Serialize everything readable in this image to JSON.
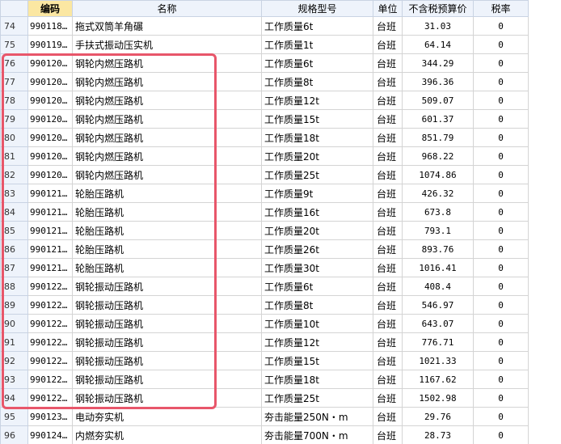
{
  "headers": {
    "row": "",
    "code": "编码",
    "name": "名称",
    "spec": "规格型号",
    "unit": "单位",
    "price": "不含税预算价",
    "tax": "税率"
  },
  "rows": [
    {
      "n": "74",
      "code": "990118…",
      "name": "拖式双筒羊角碾",
      "spec": "工作质量6t",
      "unit": "台班",
      "price": "31.03",
      "tax": "0"
    },
    {
      "n": "75",
      "code": "990119…",
      "name": "手扶式振动压实机",
      "spec": "工作质量1t",
      "unit": "台班",
      "price": "64.14",
      "tax": "0"
    },
    {
      "n": "76",
      "code": "990120…",
      "name": "钢轮内燃压路机",
      "spec": "工作质量6t",
      "unit": "台班",
      "price": "344.29",
      "tax": "0"
    },
    {
      "n": "77",
      "code": "990120…",
      "name": "钢轮内燃压路机",
      "spec": "工作质量8t",
      "unit": "台班",
      "price": "396.36",
      "tax": "0"
    },
    {
      "n": "78",
      "code": "990120…",
      "name": "钢轮内燃压路机",
      "spec": "工作质量12t",
      "unit": "台班",
      "price": "509.07",
      "tax": "0"
    },
    {
      "n": "79",
      "code": "990120…",
      "name": "钢轮内燃压路机",
      "spec": "工作质量15t",
      "unit": "台班",
      "price": "601.37",
      "tax": "0"
    },
    {
      "n": "80",
      "code": "990120…",
      "name": "钢轮内燃压路机",
      "spec": "工作质量18t",
      "unit": "台班",
      "price": "851.79",
      "tax": "0"
    },
    {
      "n": "81",
      "code": "990120…",
      "name": "钢轮内燃压路机",
      "spec": "工作质量20t",
      "unit": "台班",
      "price": "968.22",
      "tax": "0"
    },
    {
      "n": "82",
      "code": "990120…",
      "name": "钢轮内燃压路机",
      "spec": "工作质量25t",
      "unit": "台班",
      "price": "1074.86",
      "tax": "0"
    },
    {
      "n": "83",
      "code": "990121…",
      "name": "轮胎压路机",
      "spec": "工作质量9t",
      "unit": "台班",
      "price": "426.32",
      "tax": "0"
    },
    {
      "n": "84",
      "code": "990121…",
      "name": "轮胎压路机",
      "spec": "工作质量16t",
      "unit": "台班",
      "price": "673.8",
      "tax": "0"
    },
    {
      "n": "85",
      "code": "990121…",
      "name": "轮胎压路机",
      "spec": "工作质量20t",
      "unit": "台班",
      "price": "793.1",
      "tax": "0"
    },
    {
      "n": "86",
      "code": "990121…",
      "name": "轮胎压路机",
      "spec": "工作质量26t",
      "unit": "台班",
      "price": "893.76",
      "tax": "0"
    },
    {
      "n": "87",
      "code": "990121…",
      "name": "轮胎压路机",
      "spec": "工作质量30t",
      "unit": "台班",
      "price": "1016.41",
      "tax": "0"
    },
    {
      "n": "88",
      "code": "990122…",
      "name": "钢轮振动压路机",
      "spec": "工作质量6t",
      "unit": "台班",
      "price": "408.4",
      "tax": "0"
    },
    {
      "n": "89",
      "code": "990122…",
      "name": "钢轮振动压路机",
      "spec": "工作质量8t",
      "unit": "台班",
      "price": "546.97",
      "tax": "0"
    },
    {
      "n": "90",
      "code": "990122…",
      "name": "钢轮振动压路机",
      "spec": "工作质量10t",
      "unit": "台班",
      "price": "643.07",
      "tax": "0"
    },
    {
      "n": "91",
      "code": "990122…",
      "name": "钢轮振动压路机",
      "spec": "工作质量12t",
      "unit": "台班",
      "price": "776.71",
      "tax": "0"
    },
    {
      "n": "92",
      "code": "990122…",
      "name": "钢轮振动压路机",
      "spec": "工作质量15t",
      "unit": "台班",
      "price": "1021.33",
      "tax": "0"
    },
    {
      "n": "93",
      "code": "990122…",
      "name": "钢轮振动压路机",
      "spec": "工作质量18t",
      "unit": "台班",
      "price": "1167.62",
      "tax": "0"
    },
    {
      "n": "94",
      "code": "990122…",
      "name": "钢轮振动压路机",
      "spec": "工作质量25t",
      "unit": "台班",
      "price": "1502.98",
      "tax": "0"
    },
    {
      "n": "95",
      "code": "990123…",
      "name": "电动夯实机",
      "spec": "夯击能量250N・m",
      "unit": "台班",
      "price": "29.76",
      "tax": "0"
    },
    {
      "n": "96",
      "code": "990124…",
      "name": "内燃夯实机",
      "spec": "夯击能量700N・m",
      "unit": "台班",
      "price": "28.73",
      "tax": "0"
    }
  ],
  "colors": {
    "header_bg": "#eef3fb",
    "header_highlight": "#fbe7a2",
    "highlight_border": "#e8566a",
    "grid_line": "#d4d4d4"
  }
}
